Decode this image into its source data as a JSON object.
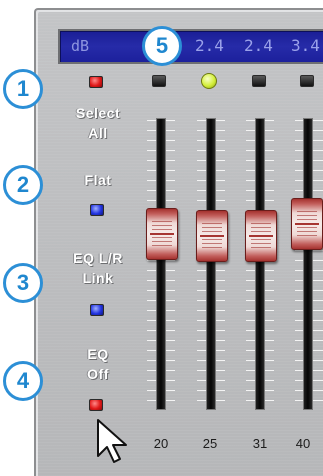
{
  "display": {
    "unit": "dB",
    "readouts": [
      "2.4",
      "2.4",
      "3.4"
    ]
  },
  "badges": [
    "1",
    "2",
    "3",
    "4",
    "5"
  ],
  "controls": {
    "select_all_label": "Select\nAll",
    "flat_label": "Flat",
    "eq_link_label": "EQ L/R\nLink",
    "eq_off_label": "EQ\nOff"
  },
  "indicators": {
    "select_all": "red",
    "flat": "blue",
    "eq_link": "blue",
    "eq_off": "red"
  },
  "band_leds": [
    "off",
    "on",
    "off",
    "off"
  ],
  "bands": [
    {
      "frequency": "20"
    },
    {
      "frequency": "25"
    },
    {
      "frequency": "31"
    },
    {
      "frequency": "40"
    }
  ],
  "colors": {
    "badge_accent": "#2c8fd6",
    "panel": "#bcbdbf",
    "display": "#1f24a0",
    "slider_handle": "#b8403c"
  }
}
